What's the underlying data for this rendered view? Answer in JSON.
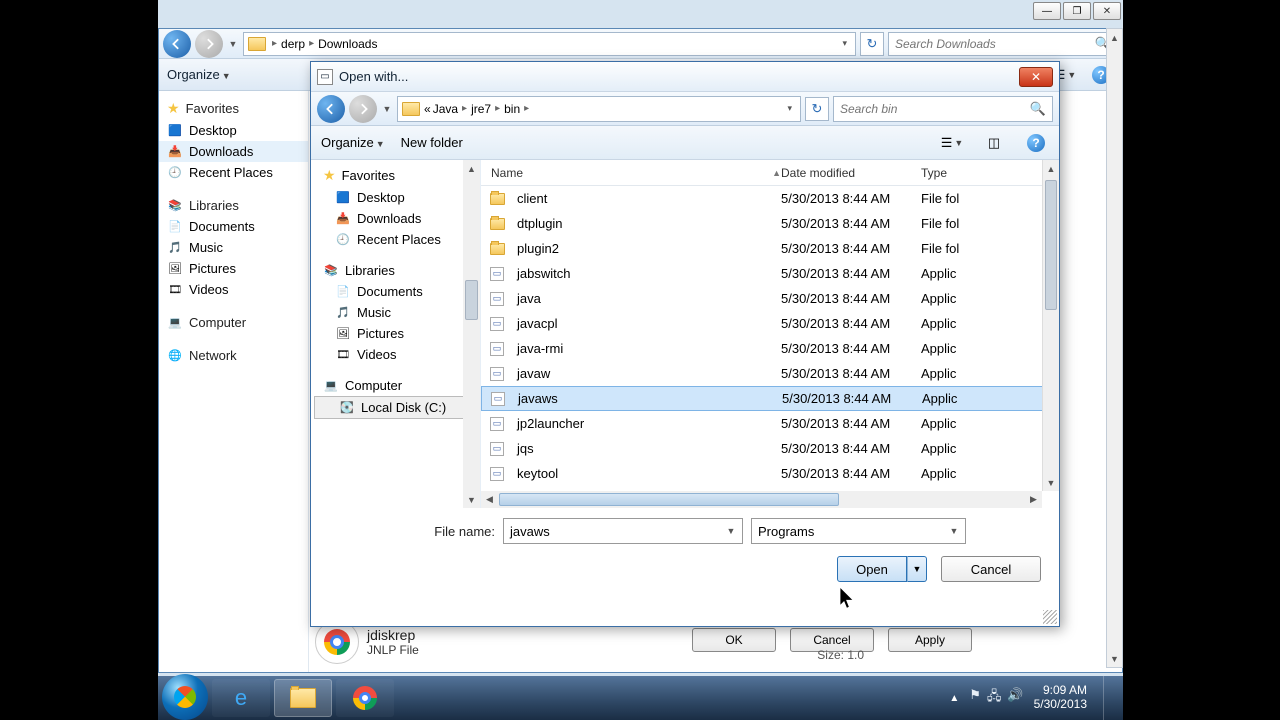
{
  "parent_window": {
    "breadcrumb": [
      "derp",
      "Downloads"
    ],
    "search_placeholder": "Search Downloads",
    "toolbar": {
      "organize": "Organize"
    },
    "tree": {
      "favorites": {
        "label": "Favorites",
        "items": [
          "Desktop",
          "Downloads",
          "Recent Places"
        ]
      },
      "libraries": {
        "label": "Libraries",
        "items": [
          "Documents",
          "Music",
          "Pictures",
          "Videos"
        ]
      },
      "computer": {
        "label": "Computer"
      },
      "network": {
        "label": "Network"
      }
    },
    "selected_file": {
      "name": "jdiskrep",
      "type": "JNLP File",
      "size_label": "Size:",
      "size_value": "1.0"
    }
  },
  "behind_buttons": {
    "ok": "OK",
    "cancel": "Cancel",
    "apply": "Apply"
  },
  "openwith": {
    "title": "Open with...",
    "breadcrumb_prefix": "«",
    "breadcrumb": [
      "Java",
      "jre7",
      "bin"
    ],
    "search_placeholder": "Search bin",
    "toolbar": {
      "organize": "Organize",
      "new_folder": "New folder"
    },
    "tree": {
      "favorites": {
        "label": "Favorites",
        "items": [
          "Desktop",
          "Downloads",
          "Recent Places"
        ]
      },
      "libraries": {
        "label": "Libraries",
        "items": [
          "Documents",
          "Music",
          "Pictures",
          "Videos"
        ]
      },
      "computer": {
        "label": "Computer",
        "items": [
          "Local Disk (C:)"
        ]
      }
    },
    "columns": {
      "name": "Name",
      "date": "Date modified",
      "type": "Type"
    },
    "rows": [
      {
        "name": "client",
        "date": "5/30/2013 8:44 AM",
        "type": "File fol",
        "kind": "folder"
      },
      {
        "name": "dtplugin",
        "date": "5/30/2013 8:44 AM",
        "type": "File fol",
        "kind": "folder"
      },
      {
        "name": "plugin2",
        "date": "5/30/2013 8:44 AM",
        "type": "File fol",
        "kind": "folder"
      },
      {
        "name": "jabswitch",
        "date": "5/30/2013 8:44 AM",
        "type": "Applic",
        "kind": "app"
      },
      {
        "name": "java",
        "date": "5/30/2013 8:44 AM",
        "type": "Applic",
        "kind": "app"
      },
      {
        "name": "javacpl",
        "date": "5/30/2013 8:44 AM",
        "type": "Applic",
        "kind": "app"
      },
      {
        "name": "java-rmi",
        "date": "5/30/2013 8:44 AM",
        "type": "Applic",
        "kind": "app"
      },
      {
        "name": "javaw",
        "date": "5/30/2013 8:44 AM",
        "type": "Applic",
        "kind": "app"
      },
      {
        "name": "javaws",
        "date": "5/30/2013 8:44 AM",
        "type": "Applic",
        "kind": "app",
        "selected": true
      },
      {
        "name": "jp2launcher",
        "date": "5/30/2013 8:44 AM",
        "type": "Applic",
        "kind": "app"
      },
      {
        "name": "jqs",
        "date": "5/30/2013 8:44 AM",
        "type": "Applic",
        "kind": "app"
      },
      {
        "name": "keytool",
        "date": "5/30/2013 8:44 AM",
        "type": "Applic",
        "kind": "app"
      }
    ],
    "filename_label": "File name:",
    "filename_value": "javaws",
    "filter_value": "Programs",
    "open_label": "Open",
    "cancel_label": "Cancel"
  },
  "taskbar": {
    "time": "9:09 AM",
    "date": "5/30/2013"
  }
}
